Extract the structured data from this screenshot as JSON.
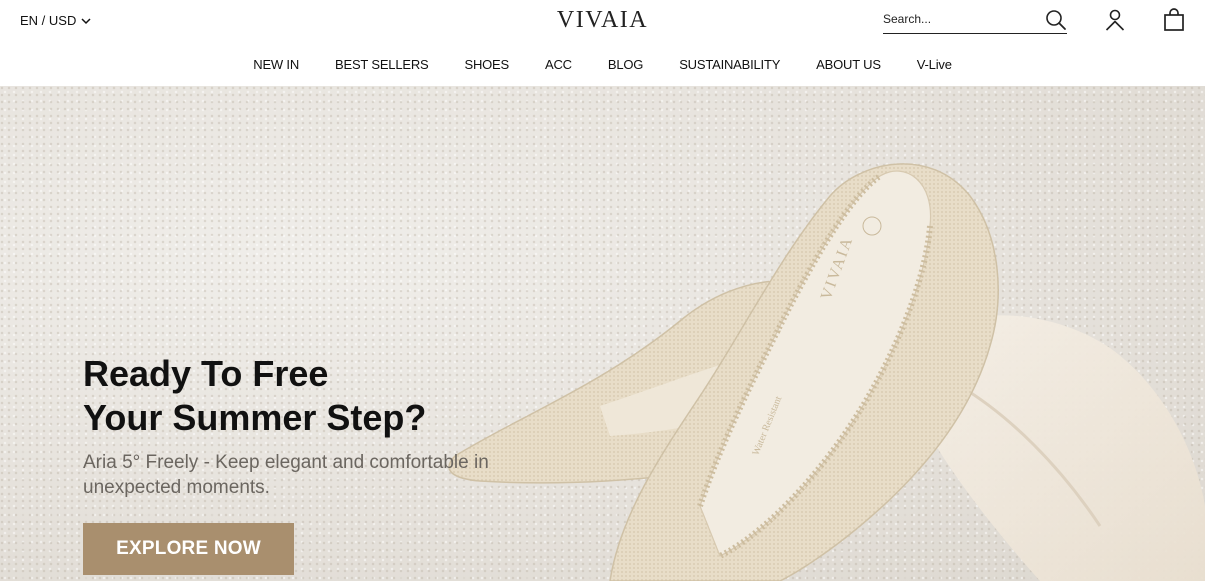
{
  "header": {
    "locale": "EN / USD",
    "logo": "VIVAIA",
    "search_placeholder": "Search..."
  },
  "nav": {
    "items": [
      {
        "label": "NEW IN"
      },
      {
        "label": "BEST SELLERS"
      },
      {
        "label": "SHOES"
      },
      {
        "label": "ACC"
      },
      {
        "label": "BLOG"
      },
      {
        "label": "SUSTAINABILITY"
      },
      {
        "label": "ABOUT US"
      },
      {
        "label": "V-Live"
      }
    ]
  },
  "hero": {
    "headline_line1": "Ready To Free",
    "headline_line2": "Your Summer Step?",
    "subline": "Aria 5° Freely - Keep elegant and comfortable in unexpected moments.",
    "cta_label": "EXPLORE NOW",
    "insole_brand": "VIVAIA",
    "insole_text": "Water Resistant"
  },
  "colors": {
    "cta_background": "#a98f6e",
    "shoe_knit": "#e7dcc6"
  },
  "icons": {
    "locale_chevron": "chevron-down-icon",
    "search": "search-icon",
    "account": "user-icon",
    "cart": "shopping-bag-icon"
  }
}
